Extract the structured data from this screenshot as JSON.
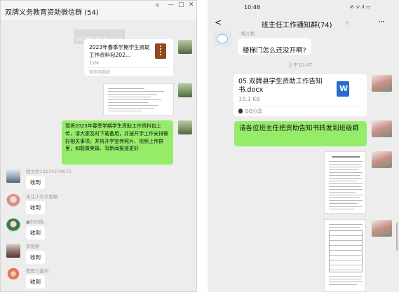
{
  "left": {
    "title": "双牌义务教育资助微信群 (54)",
    "window_controls": [
      "ꟼ",
      "—",
      "□",
      "✕"
    ],
    "timestamp": "2023年2月3日 11:03",
    "file_card": {
      "name": "2023年春季学期学生资助工作资料包202...",
      "size": "22M",
      "source": "微信电脑版"
    },
    "announcement": "现将2023年春季学期学生资助工作资料包上传，请大家及时下载备用，并按开学工作安排做好相关事项，并将开学宣传照片、视频上传群里，如能做美篇、写新闻报道更好",
    "replies": [
      {
        "name": "胡文君13174279075",
        "text": "收到"
      },
      {
        "name": "永江小学文如敏",
        "text": "收到"
      },
      {
        "name": "●刘巧梅",
        "text": "收到"
      },
      {
        "name": "邓银娇",
        "text": "收到"
      },
      {
        "name": "教田口鉴利",
        "text": "收到"
      }
    ]
  },
  "right": {
    "status_time": "10:48",
    "status_icons": "⊘ ᯤ.ıl ▭",
    "title": "班主任工作通知群(74)",
    "title_icon": "⊘",
    "back": "<",
    "more": "···",
    "partial_name": "娟儿桃",
    "question": "楼梯门怎么还没开啊?",
    "time_label": "上午10:47",
    "file_card": {
      "name": "05.双牌县学生资助工作告知书.docx",
      "size": "19.1 KB",
      "source": "QQ分享",
      "icon_text": "W"
    },
    "notice": "请各位班主任把资助告知书转发到班级群"
  },
  "colors": {
    "green_bubble": "#95ec69",
    "chat_bg": "#ededed",
    "word_blue": "#2b6ad1",
    "archive_brown": "#8a4b24"
  }
}
